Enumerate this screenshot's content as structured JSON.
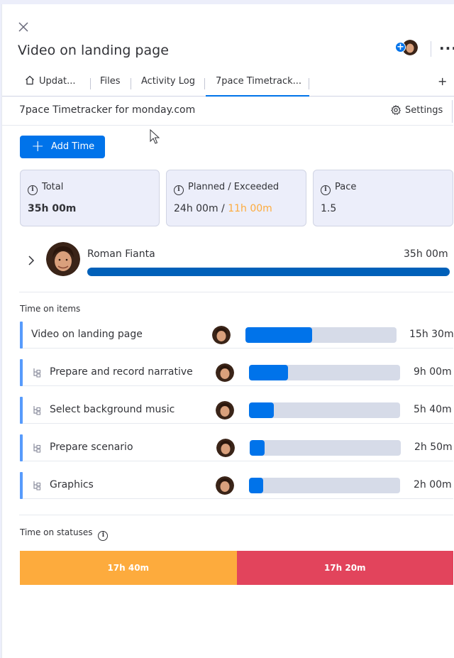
{
  "header": {
    "title": "Video on landing page"
  },
  "tabs": [
    {
      "label": "Updat..."
    },
    {
      "label": "Files"
    },
    {
      "label": "Activity Log"
    },
    {
      "label": "7pace Timetrack..."
    }
  ],
  "tab_add": "+",
  "subheader": {
    "title": "7pace Timetracker for monday.com",
    "settings_label": "Settings"
  },
  "add_time_label": "Add Time",
  "summary": {
    "total_label": "Total",
    "total_value": "35h 00m",
    "planned_label": "Planned / Exceeded",
    "planned_value": "24h 00m",
    "planned_sep": " / ",
    "exceeded_value": "11h 00m",
    "pace_label": "Pace",
    "pace_value": "1.5"
  },
  "user": {
    "name": "Roman Fianta",
    "time": "35h 00m",
    "progress": 1.0
  },
  "time_on_items_label": "Time on items",
  "items": [
    {
      "name": "Video on landing page",
      "time": "15h 30m",
      "progress": 0.443,
      "subitem": false
    },
    {
      "name": "Prepare and record narrative",
      "time": "9h 00m",
      "progress": 0.257,
      "subitem": true
    },
    {
      "name": "Select background music",
      "time": "5h 40m",
      "progress": 0.162,
      "subitem": true
    },
    {
      "name": "Prepare scenario",
      "time": "2h 50m",
      "progress": 0.098,
      "subitem": true
    },
    {
      "name": "Graphics",
      "time": "2h 00m",
      "progress": 0.095,
      "subitem": true
    }
  ],
  "time_on_statuses_label": "Time on statuses",
  "statuses": [
    {
      "label": "17h 40m",
      "share": 0.5,
      "color": "#fdab3d"
    },
    {
      "label": "17h 20m",
      "share": 0.5,
      "color": "#e2445c"
    }
  ],
  "colors": {
    "primary": "#0073ea",
    "user_bar": "#0060b9",
    "exceeded": "#fdab3d"
  }
}
